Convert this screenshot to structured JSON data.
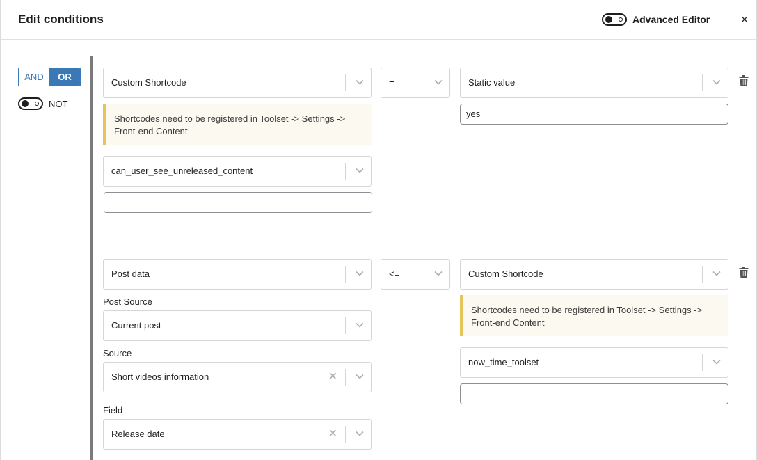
{
  "header": {
    "title": "Edit conditions",
    "advanced_editor_label": "Advanced Editor",
    "close_glyph": "×"
  },
  "logic": {
    "and_label": "AND",
    "or_label": "OR",
    "selected": "OR",
    "not_label": "NOT"
  },
  "conditions": [
    {
      "left_select": "Custom Shortcode",
      "left_notice": "Shortcodes need to be registered in Toolset -> Settings -> Front-end Content",
      "left_shortcode": "can_user_see_unreleased_content",
      "left_input_value": "",
      "operator": "=",
      "right_select": "Static value",
      "right_input_value": "yes"
    },
    {
      "left_select": "Post data",
      "post_source_label": "Post Source",
      "post_source": "Current post",
      "source_label": "Source",
      "source": "Short videos information",
      "field_label": "Field",
      "field": "Release date",
      "operator": "<=",
      "right_select": "Custom Shortcode",
      "right_notice": "Shortcodes need to be registered in Toolset -> Settings -> Front-end Content",
      "right_shortcode": "now_time_toolset",
      "right_input_value": ""
    }
  ],
  "icons": {
    "close": "close-icon",
    "trash": "trash-icon",
    "chevron": "chevron-down-icon",
    "clear": "clear-icon"
  },
  "colors": {
    "accent": "#3a78b6",
    "notice_border": "#e7c45b",
    "notice_bg": "#fcf9f1"
  }
}
